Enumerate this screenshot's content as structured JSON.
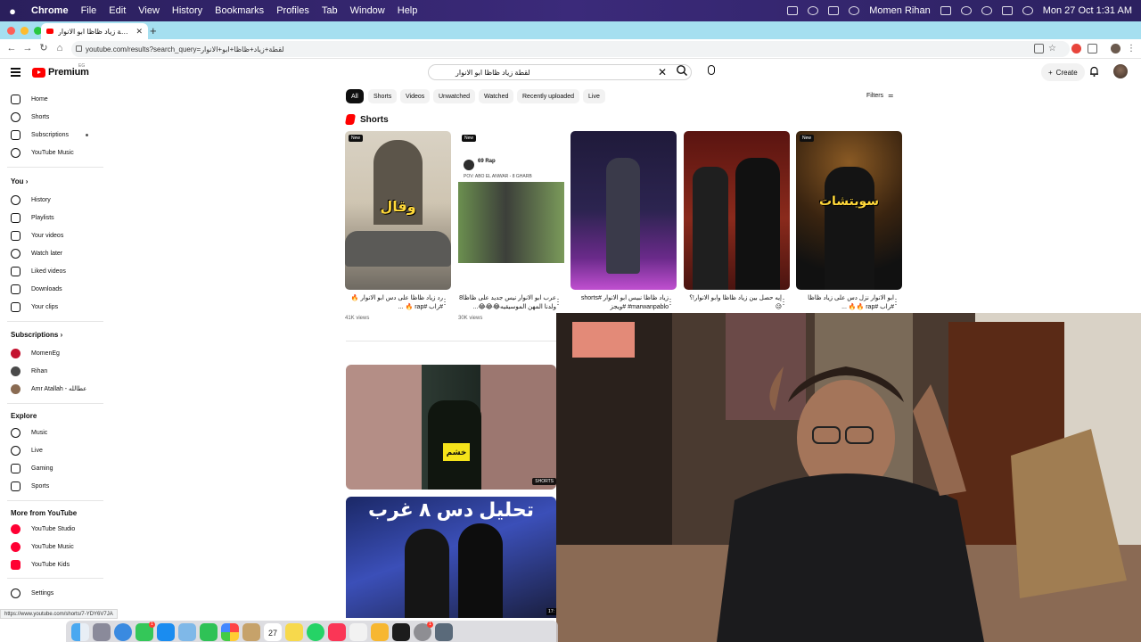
{
  "menubar": {
    "apple": "",
    "items": [
      "Chrome",
      "File",
      "Edit",
      "View",
      "History",
      "Bookmarks",
      "Profiles",
      "Tab",
      "Window",
      "Help"
    ],
    "user": "Momen Rihan",
    "datetime": "Mon 27 Oct  1:31 AM"
  },
  "browser": {
    "tab_title": "لقطة زياد ظاظا ابو الانوار - YouTube",
    "url": "youtube.com/results?search_query=لقطة+زياد+ظاظا+ابو+الانوار",
    "status_url": "https://www.youtube.com/shorts/7-YDY6V7JA"
  },
  "youtube": {
    "logo_text": "Premium",
    "country_code": "EG",
    "search_value": "لقطة زياد ظاظا ابو الانوار",
    "create_label": "Create"
  },
  "sidebar": {
    "main": [
      {
        "label": "Home",
        "icon": "home-icon"
      },
      {
        "label": "Shorts",
        "icon": "shorts-icon"
      },
      {
        "label": "Subscriptions",
        "icon": "subscriptions-icon"
      },
      {
        "label": "YouTube Music",
        "icon": "music-icon"
      }
    ],
    "you_heading": "You",
    "you": [
      {
        "label": "History",
        "icon": "history-icon"
      },
      {
        "label": "Playlists",
        "icon": "playlists-icon"
      },
      {
        "label": "Your videos",
        "icon": "your-videos-icon"
      },
      {
        "label": "Watch later",
        "icon": "watch-later-icon"
      },
      {
        "label": "Liked videos",
        "icon": "like-icon"
      },
      {
        "label": "Downloads",
        "icon": "download-icon"
      },
      {
        "label": "Your clips",
        "icon": "scissors-icon"
      }
    ],
    "subs_heading": "Subscriptions",
    "subs": [
      {
        "label": "MomenEg",
        "color": "#c4122f"
      },
      {
        "label": "Rihan",
        "color": "#4a4a4a"
      },
      {
        "label": "Amr Atallah - عطالله",
        "color": "#8a6b52"
      }
    ],
    "explore_heading": "Explore",
    "explore": [
      {
        "label": "Music",
        "icon": "music-note-icon"
      },
      {
        "label": "Live",
        "icon": "live-icon"
      },
      {
        "label": "Gaming",
        "icon": "gaming-icon"
      },
      {
        "label": "Sports",
        "icon": "trophy-icon"
      }
    ],
    "more_heading": "More from YouTube",
    "more": [
      {
        "label": "YouTube Studio",
        "color": "#ff0033"
      },
      {
        "label": "YouTube Music",
        "color": "#ff0033"
      },
      {
        "label": "YouTube Kids",
        "color": "#ff0033"
      }
    ],
    "settings": "Settings"
  },
  "chips": [
    "All",
    "Shorts",
    "Videos",
    "Unwatched",
    "Watched",
    "Recently uploaded",
    "Live"
  ],
  "filters_label": "Filters",
  "shorts_heading": "Shorts",
  "shorts": [
    {
      "badge": "New",
      "overlay": "وقال",
      "caption": "رد زياد ظاظا على دس ابو الانوار 🔥 #راب #rap 🔥 ...",
      "views": "41K views"
    },
    {
      "badge": "New",
      "overlay": "",
      "caption": "عرب ابو الانوار نيس جديد على ظاظا8 ولدنا المهن الموسيقيه😂😂😂...",
      "views": "30K views",
      "channel": "69 Rap",
      "sub": "POV: ABO EL ANWAR - 8 GHARB"
    },
    {
      "badge": "",
      "overlay": "",
      "caption": "زياد ظاظا نبيس ابو الانوار #shorts #marwanpablo #ويجز",
      "views": ""
    },
    {
      "badge": "",
      "overlay": "",
      "caption": "إيه حصل بين زياد ظاظا وابو الانوار!؟ 😥",
      "views": ""
    },
    {
      "badge": "New",
      "overlay": "سويتشات",
      "caption": "ابو الانوار نزل دس على زياد ظاظا #راب #rap 🔥🔥 ...",
      "views": ""
    }
  ],
  "results": {
    "thumb1_badge": "SHORTS",
    "thumb1_overlay": "خشم",
    "thumb2_title": "تحليل دس ٨ غرب",
    "thumb2_duration": "17:"
  },
  "dock": [
    "Finder",
    "Launchpad",
    "Safari",
    "Messages",
    "App Store",
    "Preview",
    "FaceTime",
    "Photos",
    "Notes",
    "Calendar",
    "Stickies",
    "WhatsApp",
    "Music",
    "Reminders",
    "Sketch",
    "Terminal",
    "System Settings",
    "Screen"
  ],
  "colors": {
    "menubar": "#2f2468",
    "tabstrip": "#a5dff0",
    "brand_red": "#ff0000"
  }
}
